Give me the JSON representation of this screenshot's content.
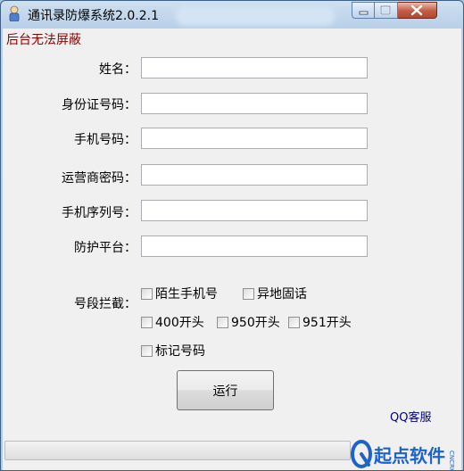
{
  "window": {
    "title": "通讯录防爆系统2.0.2.1"
  },
  "notice": "后台无法屏蔽",
  "fields": [
    {
      "label": "姓名：",
      "value": ""
    },
    {
      "label": "身份证号码：",
      "value": ""
    },
    {
      "label": "手机号码：",
      "value": ""
    },
    {
      "label": "运营商密码：",
      "value": ""
    },
    {
      "label": "手机序列号：",
      "value": ""
    },
    {
      "label": "防护平台：",
      "value": ""
    }
  ],
  "block": {
    "label": "号段拦截：",
    "options": [
      {
        "label": "陌生手机号",
        "checked": false
      },
      {
        "label": "异地固话",
        "checked": false
      },
      {
        "label": "400开头",
        "checked": false
      },
      {
        "label": "950开头",
        "checked": false
      },
      {
        "label": "951开头",
        "checked": false
      },
      {
        "label": "标记号码",
        "checked": false
      }
    ]
  },
  "run_label": "运行",
  "qq_service": "QQ客服",
  "progress": 0,
  "watermark": {
    "text": "起点软件",
    "sub": "CNCRK"
  }
}
